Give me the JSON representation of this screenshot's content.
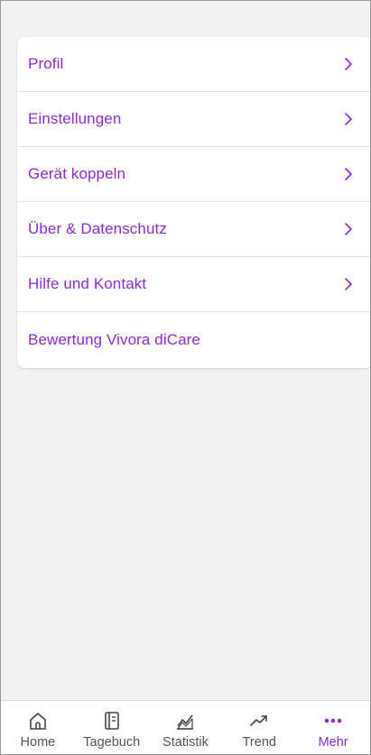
{
  "menu": {
    "items": [
      {
        "label": "Profil",
        "chevron": true
      },
      {
        "label": "Einstellungen",
        "chevron": true
      },
      {
        "label": "Gerät koppeln",
        "chevron": true
      },
      {
        "label": "Über & Datenschutz",
        "chevron": true
      },
      {
        "label": "Hilfe und Kontakt",
        "chevron": true
      },
      {
        "label": "Bewertung Vivora diCare",
        "chevron": false
      }
    ]
  },
  "tabbar": {
    "tabs": [
      {
        "label": "Home",
        "icon": "home-icon",
        "active": false
      },
      {
        "label": "Tagebuch",
        "icon": "diary-icon",
        "active": false
      },
      {
        "label": "Statistik",
        "icon": "statistics-icon",
        "active": false
      },
      {
        "label": "Trend",
        "icon": "trend-icon",
        "active": false
      },
      {
        "label": "Mehr",
        "icon": "more-icon",
        "active": true
      }
    ]
  },
  "colors": {
    "accent": "#8a2be2",
    "background": "#f2f2f2",
    "tab_inactive": "#555555"
  }
}
